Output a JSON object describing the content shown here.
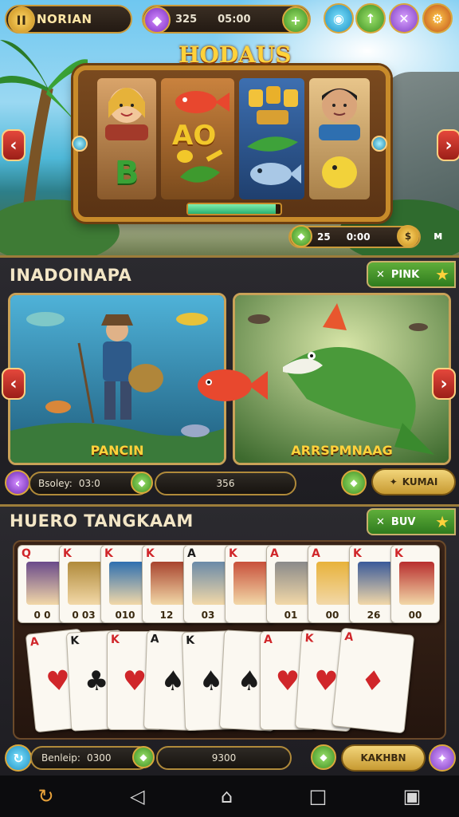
{
  "header": {
    "title": "NORIAN",
    "balance_a": "325",
    "balance_b": "05:00",
    "pause_icon": "pause-icon",
    "gem_icon": "gem-icon",
    "buttons": [
      {
        "name": "globe-icon",
        "glyph": "◉"
      },
      {
        "name": "upgrade-icon",
        "glyph": "↑"
      },
      {
        "name": "swords-icon",
        "glyph": "✕"
      },
      {
        "name": "settings-icon",
        "glyph": "⚙"
      }
    ]
  },
  "slot": {
    "title": "HODAUS",
    "symbols": {
      "r1": [
        "",
        "B"
      ],
      "r2": [
        "",
        "AO",
        ""
      ],
      "r3": [
        "",
        ""
      ],
      "r4": [
        "",
        ""
      ]
    },
    "progress_fraction": 0.95,
    "stats_a": "25",
    "stats_b": "0:00",
    "side_mark": "ᴍ"
  },
  "section1": {
    "title": "INADOINAPA",
    "tab_label": "PINK",
    "cards": [
      {
        "label": "PANCIN"
      },
      {
        "label": "ARRSPMNAAG"
      }
    ],
    "bar_label": "Bsoley:",
    "bar_value": "03:0",
    "bar_center": "356",
    "button_label": "KUMAI"
  },
  "section2": {
    "title": "HUERO TANGKAAM",
    "tab_label": "BUV",
    "top_row": [
      {
        "rank": "Q",
        "suit": "♥",
        "val": "0 0"
      },
      {
        "rank": "K",
        "suit": "♥",
        "val": "0 03"
      },
      {
        "rank": "K",
        "suit": "♥",
        "val": "010"
      },
      {
        "rank": "K",
        "suit": "♦",
        "val": "12"
      },
      {
        "rank": "A",
        "suit": "♠",
        "val": "03"
      },
      {
        "rank": "K",
        "suit": "♥",
        "val": ""
      },
      {
        "rank": "A",
        "suit": "♥",
        "val": "01"
      },
      {
        "rank": "A",
        "suit": "♥",
        "val": "00"
      },
      {
        "rank": "K",
        "suit": "♥",
        "val": "26"
      },
      {
        "rank": "K",
        "suit": "♦",
        "val": "00"
      }
    ],
    "bottom_row": [
      {
        "rank": "A",
        "suit": "♥"
      },
      {
        "rank": "K",
        "suit": "♣"
      },
      {
        "rank": "K",
        "suit": "♥"
      },
      {
        "rank": "A",
        "suit": "♠"
      },
      {
        "rank": "K",
        "suit": "♠"
      },
      {
        "rank": "",
        "suit": "♠"
      },
      {
        "rank": "A",
        "suit": "♥"
      },
      {
        "rank": "K",
        "suit": "♥"
      },
      {
        "rank": "A",
        "suit": "♦"
      }
    ],
    "bar_label": "Benleip:",
    "bar_value": "0300",
    "bar_center": "9300",
    "button_label": "KAKHBN"
  },
  "colors": {
    "gold": "#c9a258",
    "green_tab": "#4a9a2c",
    "red_arrow": "#c8332a",
    "panel_bg": "#25242a"
  },
  "sysnav": {
    "icons": [
      "refresh-icon",
      "back-icon",
      "home-icon",
      "recents-icon",
      "overview-icon"
    ]
  }
}
